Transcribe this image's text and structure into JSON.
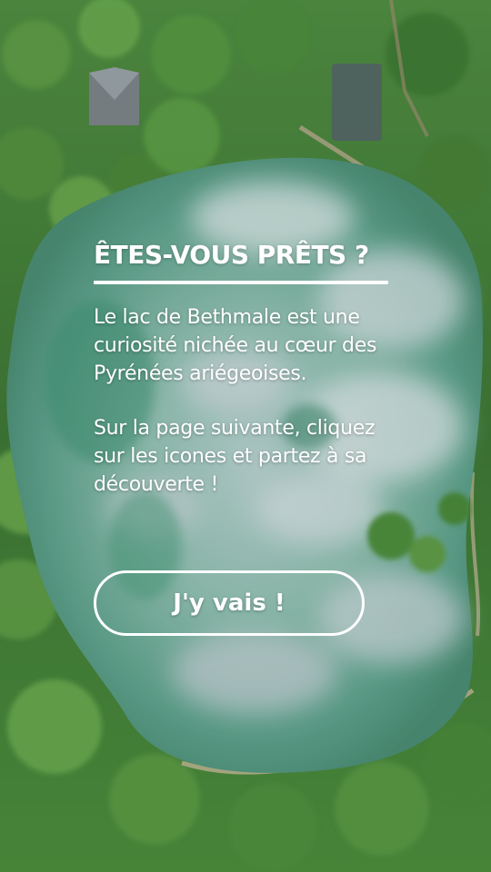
{
  "intro": {
    "title": "ÊTES-VOUS PRÊTS ?",
    "paragraph_1": "Le lac de Bethmale est une curiosité nichée au cœur des Pyrénées ariégeoises.",
    "paragraph_2": "Sur la page suivante, cliquez sur les icones et partez à sa découverte !",
    "cta_label": "J'y vais !"
  },
  "background": {
    "subject": "aerial view of a lake surrounded by forest",
    "colors": {
      "forest": "#3f7a3c",
      "water": "#7fb3a6",
      "cloud_reflection": "#c9d6dc",
      "path": "#c8b79a",
      "text": "#ffffff"
    }
  }
}
